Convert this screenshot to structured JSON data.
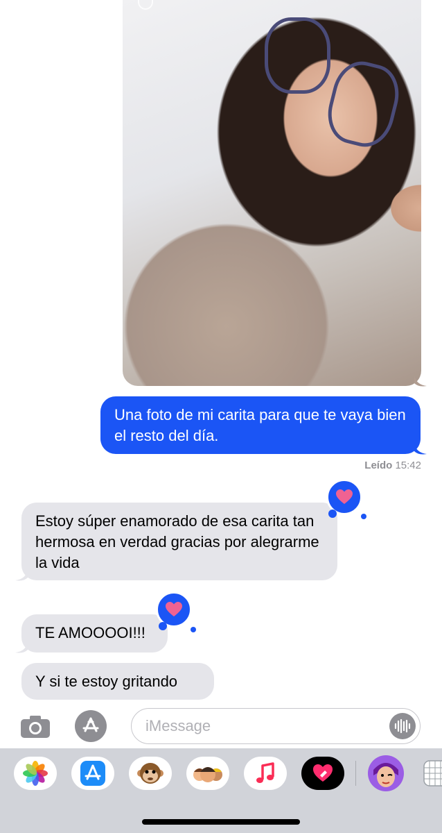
{
  "conversation": {
    "sent_photo_alt": "",
    "sent_message": "Una foto de mi carita para que te vaya bien el resto del día.",
    "read_receipt": {
      "label": "Leído",
      "time": "15:42"
    },
    "received": [
      {
        "text": "Estoy súper enamorado de esa carita tan hermosa en verdad gracias por alegrarme la vida",
        "tapback": "heart"
      },
      {
        "text": "TE AMOOOOI!!!",
        "tapback": "heart"
      },
      {
        "text": "Y si te estoy gritando",
        "tapback": null
      }
    ]
  },
  "composer": {
    "placeholder": "iMessage",
    "camera_icon": "camera-icon",
    "appstore_icon": "appstore-icon",
    "audio_icon": "waveform-icon"
  },
  "drawer": {
    "apps": [
      "photos-icon",
      "appstore-icon",
      "animoji-icon",
      "memoji-stickers-icon",
      "music-icon",
      "digital-touch-icon",
      "memoji-icon",
      "more-apps-icon"
    ]
  },
  "colors": {
    "sent_bubble": "#1b55f5",
    "received_bubble": "#e5e5ea",
    "heart": "#f06292",
    "drawer_bg": "#d1d3d9"
  }
}
